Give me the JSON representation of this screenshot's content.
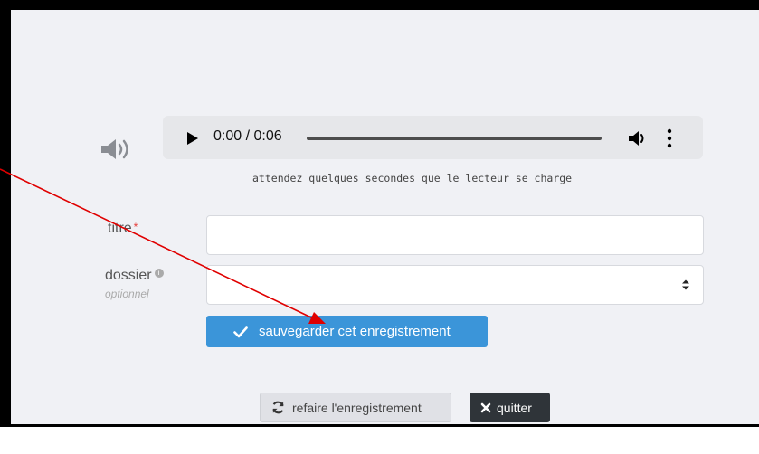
{
  "audio": {
    "time": "0:00 / 0:06",
    "hint": "attendez quelques secondes que le lecteur se charge"
  },
  "form": {
    "title_label": "titre",
    "required_mark": "*",
    "title_value": "",
    "folder_label": "dossier",
    "folder_info_icon": "i",
    "folder_optional": "optionnel",
    "folder_value": ""
  },
  "actions": {
    "save_label": "sauvegarder cet enregistrement",
    "redo_label": "refaire l'enregistrement",
    "quit_label": "quitter"
  },
  "colors": {
    "accent": "#3b95d9",
    "dark_button": "#2f3439",
    "annotation_arrow": "#e00000"
  },
  "icons": [
    "speaker-icon",
    "play-icon",
    "volume-icon",
    "more-options-icon",
    "info-icon",
    "select-arrows-icon",
    "check-icon",
    "refresh-icon",
    "close-icon"
  ]
}
